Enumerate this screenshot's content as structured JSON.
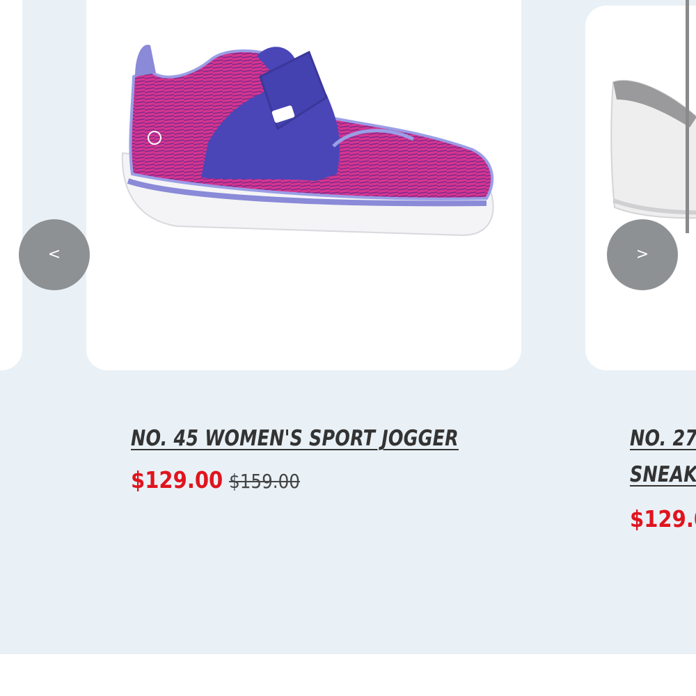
{
  "carousel": {
    "prev_label": "<",
    "next_label": ">",
    "products": [
      {
        "title": "NO. 45 WOMEN'S SPORT JOGGER",
        "sale_price": "$129.00",
        "original_price": "$159.00",
        "image": "purple-pink-sneaker"
      },
      {
        "title_lines": [
          "NO. 27",
          "SNEAK"
        ],
        "sale_price": "$129.0",
        "image": "white-sneaker"
      }
    ]
  },
  "colors": {
    "page_background": "#e9f1f6",
    "sale_price": "#e0141e",
    "nav_button": "#8e9193",
    "title": "#333333"
  }
}
